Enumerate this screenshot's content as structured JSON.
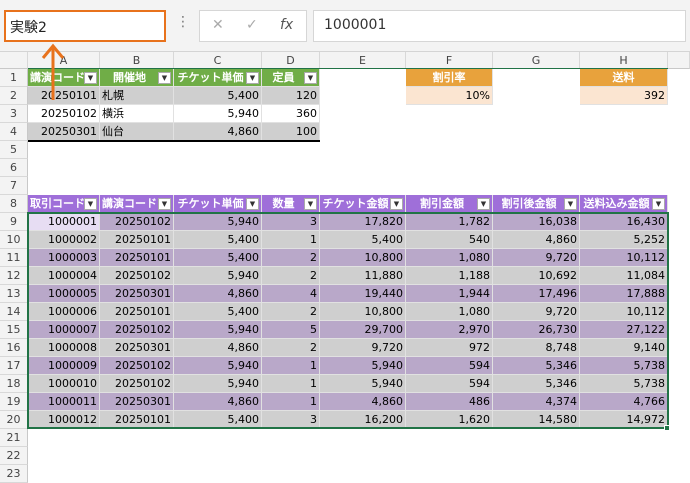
{
  "formula_bar": {
    "name_box": "実験2",
    "cancel_icon": "✕",
    "enter_icon": "✓",
    "fx_label": "fx",
    "formula_value": "1000001"
  },
  "columns": [
    "A",
    "B",
    "C",
    "D",
    "E",
    "F",
    "G",
    "H"
  ],
  "rows": [
    "1",
    "2",
    "3",
    "4",
    "5",
    "6",
    "7",
    "8",
    "9",
    "10",
    "11",
    "12",
    "13",
    "14",
    "15",
    "16",
    "17",
    "18",
    "19",
    "20",
    "21",
    "22",
    "23"
  ],
  "table1": {
    "headers": [
      "講演コード",
      "開催地",
      "チケット単価",
      "定員"
    ],
    "rows": [
      [
        "20250101",
        "札幌",
        "5,400",
        "120"
      ],
      [
        "20250102",
        "横浜",
        "5,940",
        "360"
      ],
      [
        "20250301",
        "仙台",
        "4,860",
        "100"
      ]
    ]
  },
  "discount": {
    "header": "割引率",
    "value": "10%"
  },
  "shipping": {
    "header": "送料",
    "value": "392"
  },
  "table2": {
    "headers": [
      "取引コード",
      "講演コード",
      "チケット単価",
      "数量",
      "チケット金額",
      "割引金額",
      "割引後金額",
      "送料込み金額"
    ],
    "rows": [
      [
        "1000001",
        "20250102",
        "5,940",
        "3",
        "17,820",
        "1,782",
        "16,038",
        "16,430"
      ],
      [
        "1000002",
        "20250101",
        "5,400",
        "1",
        "5,400",
        "540",
        "4,860",
        "5,252"
      ],
      [
        "1000003",
        "20250101",
        "5,400",
        "2",
        "10,800",
        "1,080",
        "9,720",
        "10,112"
      ],
      [
        "1000004",
        "20250102",
        "5,940",
        "2",
        "11,880",
        "1,188",
        "10,692",
        "11,084"
      ],
      [
        "1000005",
        "20250301",
        "4,860",
        "4",
        "19,440",
        "1,944",
        "17,496",
        "17,888"
      ],
      [
        "1000006",
        "20250101",
        "5,400",
        "2",
        "10,800",
        "1,080",
        "9,720",
        "10,112"
      ],
      [
        "1000007",
        "20250102",
        "5,940",
        "5",
        "29,700",
        "2,970",
        "26,730",
        "27,122"
      ],
      [
        "1000008",
        "20250301",
        "4,860",
        "2",
        "9,720",
        "972",
        "8,748",
        "9,140"
      ],
      [
        "1000009",
        "20250102",
        "5,940",
        "1",
        "5,940",
        "594",
        "5,346",
        "5,738"
      ],
      [
        "1000010",
        "20250102",
        "5,940",
        "1",
        "5,940",
        "594",
        "5,346",
        "5,738"
      ],
      [
        "1000011",
        "20250301",
        "4,860",
        "1",
        "4,860",
        "486",
        "4,374",
        "4,766"
      ],
      [
        "1000012",
        "20250101",
        "5,400",
        "3",
        "16,200",
        "1,620",
        "14,580",
        "14,972"
      ]
    ]
  },
  "colors": {
    "green_header": "#70ad47",
    "orange_header": "#e8a23c",
    "purple_header": "#9f6fd9",
    "purple_band": "#b9a8c9",
    "gray_band": "#cfcfcf",
    "peach": "#fbe5d1",
    "name_box_border": "#e8721c"
  }
}
